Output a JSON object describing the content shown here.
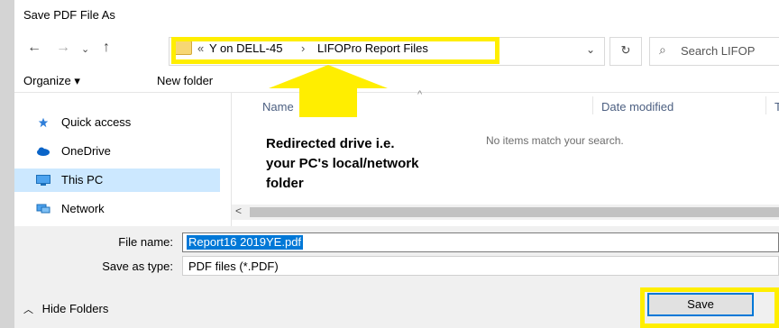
{
  "dialog": {
    "title": "Save PDF File As",
    "address": {
      "overflow": "«",
      "drive": "Y on DELL-45",
      "separator": "›",
      "folder": "LIFOPro Report Files"
    },
    "search_placeholder": "Search LIFOP"
  },
  "toolbar": {
    "organize": "Organize ▾",
    "new_folder": "New folder"
  },
  "sidebar": {
    "items": [
      {
        "label": "Quick access",
        "icon": "star-icon"
      },
      {
        "label": "OneDrive",
        "icon": "cloud-icon"
      },
      {
        "label": "This PC",
        "icon": "monitor-icon",
        "selected": true
      },
      {
        "label": "Network",
        "icon": "network-icon"
      }
    ]
  },
  "columns": {
    "name": "Name",
    "date_modified": "Date modified",
    "type": "T"
  },
  "content": {
    "empty_message": "No items match your search."
  },
  "annotation": {
    "line1": "Redirected drive i.e.",
    "line2": "your PC's local/network",
    "line3": "folder"
  },
  "fields": {
    "file_name_label": "File name:",
    "file_name_value": "Report16 2019YE.pdf",
    "save_type_label": "Save as type:",
    "save_type_value": "PDF files (*.PDF)"
  },
  "footer": {
    "hide_folders": "Hide Folders",
    "save": "Save"
  },
  "colors": {
    "highlight": "#ffee00",
    "selection": "#0078d7",
    "nav_selected": "#cce8ff"
  }
}
